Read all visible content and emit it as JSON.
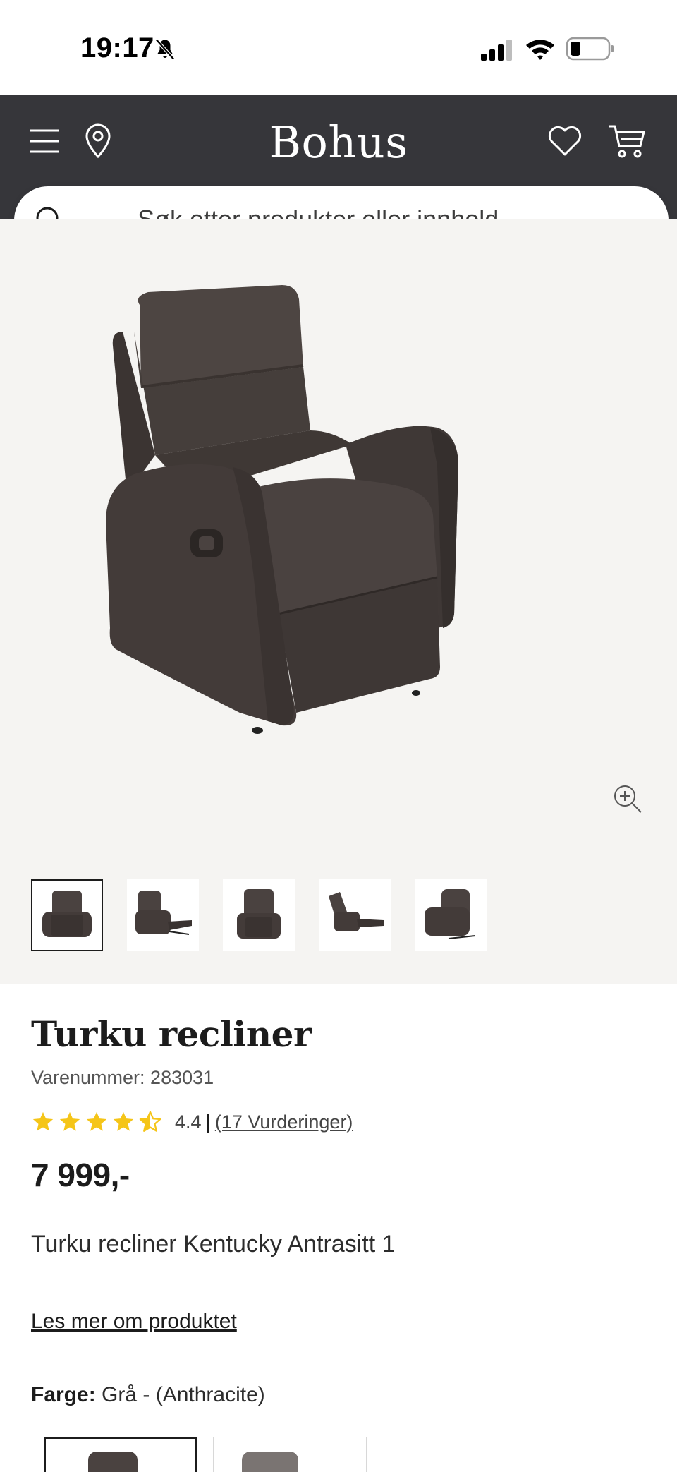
{
  "status_bar": {
    "time": "19:17"
  },
  "header": {
    "logo": "Bohus"
  },
  "search": {
    "placeholder": "Søk etter produkter eller innhold ..."
  },
  "gallery": {
    "thumbnail_count": 5,
    "active_thumbnail": 1
  },
  "product": {
    "title": "Turku recliner",
    "sku": "Varenummer: 283031",
    "rating": {
      "value": "4.4",
      "separator": "|",
      "count_text": "(17 Vurderinger)",
      "stars": 4.5
    },
    "price": "7 999,-",
    "description": "Turku recliner Kentucky Antrasitt 1",
    "read_more": "Les mer om produktet",
    "color_label": "Farge:",
    "color_value": "Grå - (Anthracite)"
  },
  "colors": {
    "header_bg": "#36363a",
    "gallery_bg": "#f5f4f2",
    "star": "#f5c518",
    "chair": "#4a4240"
  }
}
